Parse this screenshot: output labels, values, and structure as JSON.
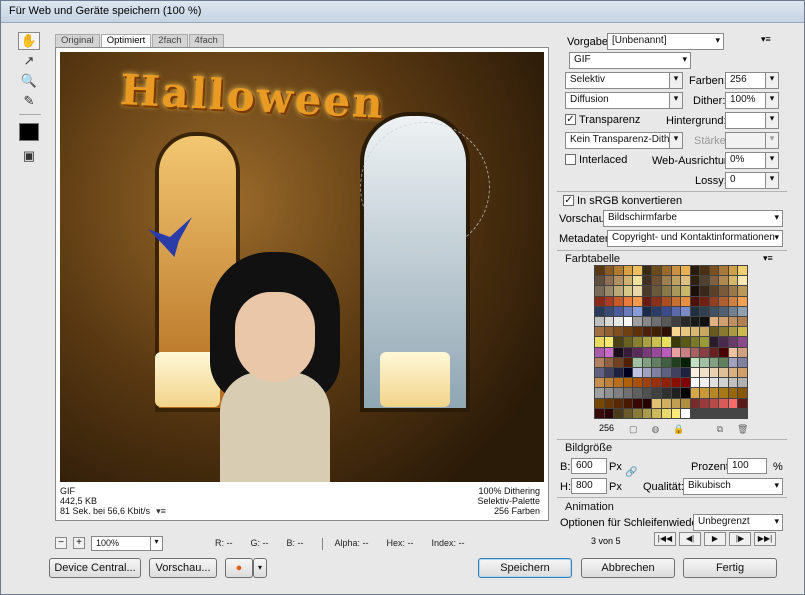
{
  "window": {
    "title": "Für Web und Geräte speichern (100 %)"
  },
  "tabs": [
    "Original",
    "Optimiert",
    "2fach",
    "4fach"
  ],
  "preview": {
    "title_art": "Halloween",
    "info_left": [
      "GIF",
      "442,5 KB",
      "81 Sek. bei 56,6 Kbit/s"
    ],
    "info_right": [
      "100% Dithering",
      "Selektiv-Palette",
      "256 Farben"
    ]
  },
  "status": {
    "zoom": "100%",
    "readouts": [
      "R: --",
      "G: --",
      "B: --",
      "Alpha: --",
      "Hex: --",
      "Index: --"
    ]
  },
  "buttons": {
    "device_central": "Device Central...",
    "preview": "Vorschau...",
    "save": "Speichern",
    "cancel": "Abbrechen",
    "done": "Fertig"
  },
  "settings": {
    "preset_label": "Vorgabe:",
    "preset_value": "[Unbenannt]",
    "format": "GIF",
    "reduction": "Selektiv",
    "colors_label": "Farben:",
    "colors_value": "256",
    "dither_algo": "Diffusion",
    "dither_label": "Dither:",
    "dither_value": "100%",
    "transparency_label": "Transparenz",
    "transparency_checked": true,
    "matte_label": "Hintergrund:",
    "matte_value": "",
    "transparency_dither": "Kein Transparenz-Dither",
    "amount_label": "Stärke:",
    "interlaced_label": "Interlaced",
    "interlaced_checked": false,
    "websnap_label": "Web-Ausrichtung:",
    "websnap_value": "0%",
    "lossy_label": "Lossy:",
    "lossy_value": "0",
    "srgb_label": "In sRGB konvertieren",
    "srgb_checked": true,
    "preview_label": "Vorschau:",
    "preview_value": "Bildschirmfarbe",
    "metadata_label": "Metadaten:",
    "metadata_value": "Copyright- und Kontaktinformationen"
  },
  "color_table": {
    "title": "Farbtabelle",
    "count": "256",
    "colors": [
      "#5a3a14",
      "#8a5a22",
      "#b07a2e",
      "#d8a040",
      "#f0c060",
      "#3a2a10",
      "#6a4a1a",
      "#9a6a2a",
      "#c89040",
      "#e8b050",
      "#2a1a08",
      "#4a3010",
      "#7a5020",
      "#a87838",
      "#d0a048",
      "#f0d070",
      "#605040",
      "#907050",
      "#b09060",
      "#d0b070",
      "#f0e0a0",
      "#403020",
      "#705030",
      "#a08050",
      "#c0a060",
      "#e0c080",
      "#302010",
      "#504030",
      "#806040",
      "#b08850",
      "#d8b868",
      "#f8e8b8",
      "#7a6a5a",
      "#9a8a6a",
      "#baa878",
      "#d8c888",
      "#e8d8a8",
      "#4a3a2a",
      "#6a5a3a",
      "#8a7a4a",
      "#aa985a",
      "#c8b86a",
      "#1a1008",
      "#3a2818",
      "#5a4028",
      "#7a5a38",
      "#9a7848",
      "#ba9858",
      "#8a2a1a",
      "#aa3a22",
      "#c85a2a",
      "#e87a3a",
      "#f89a4a",
      "#6a1a10",
      "#8a3018",
      "#aa5020",
      "#c87030",
      "#e89040",
      "#501008",
      "#702010",
      "#904020",
      "#b06030",
      "#d08040",
      "#f0a050",
      "#2a3a5a",
      "#3a4a7a",
      "#4a5a9a",
      "#6a7aba",
      "#8a9ada",
      "#1a2a4a",
      "#2a3a6a",
      "#3a4a8a",
      "#5a6aaa",
      "#7a8aca",
      "#203040",
      "#304050",
      "#405060",
      "#506070",
      "#708090",
      "#90a0b0",
      "#c0c0c0",
      "#d8d8d8",
      "#e8e8e8",
      "#f8f8f8",
      "#a0a0a0",
      "#888888",
      "#707070",
      "#585858",
      "#404040",
      "#282828",
      "#181818",
      "#101010",
      "#e0b080",
      "#d0a070",
      "#c09060",
      "#b08050",
      "#a07040",
      "#906030",
      "#805020",
      "#704010",
      "#603008",
      "#502004",
      "#402002",
      "#301000",
      "#f8d890",
      "#e8c880",
      "#d8b870",
      "#c8a860",
      "#6a5a20",
      "#8a7a30",
      "#aa9a40",
      "#caba50",
      "#eada60",
      "#fae870",
      "#4a4010",
      "#6a6020",
      "#8a8030",
      "#aaa040",
      "#cac050",
      "#eae060",
      "#3a3a08",
      "#5a5a18",
      "#7a7a28",
      "#9a9a38",
      "#2a1a2a",
      "#4a2a4a",
      "#6a3a6a",
      "#8a4a8a",
      "#aa5aaa",
      "#ca6aca",
      "#1a0a1a",
      "#3a1a3a",
      "#5a2a5a",
      "#7a3a7a",
      "#9a4a9a",
      "#ba5aba",
      "#e8a0a0",
      "#c88080",
      "#a86060",
      "#884040",
      "#682020",
      "#480000",
      "#f0c0a0",
      "#d0a080",
      "#b08060",
      "#906040",
      "#704020",
      "#502000",
      "#a0c0a0",
      "#80a080",
      "#608060",
      "#406040",
      "#204020",
      "#002000",
      "#c0e0c0",
      "#a0c0a0",
      "#80a080",
      "#608060",
      "#a0a0c0",
      "#8080a0",
      "#606080",
      "#404060",
      "#202040",
      "#000020",
      "#c0c0e0",
      "#a0a0c0",
      "#8080a0",
      "#606080",
      "#404060",
      "#202040",
      "#f8f0e0",
      "#f0e0c8",
      "#e8d0b0",
      "#e0c098",
      "#d8b080",
      "#d0a068",
      "#c89050",
      "#c08038",
      "#b87020",
      "#b06008",
      "#a85000",
      "#a04000",
      "#983000",
      "#902000",
      "#881000",
      "#800000",
      "#ffffff",
      "#f0f0f0",
      "#e0e0e0",
      "#d0d0d0",
      "#c0c0c0",
      "#b0b0b0",
      "#a0a0a0",
      "#909090",
      "#808080",
      "#707070",
      "#606060",
      "#505050",
      "#404040",
      "#303030",
      "#202020",
      "#000000",
      "#d8a848",
      "#c89838",
      "#b88828",
      "#a87818",
      "#986808",
      "#885800",
      "#784800",
      "#683800",
      "#582800",
      "#481800",
      "#380800",
      "#280000",
      "#e0c070",
      "#d0b060",
      "#c0a050",
      "#b09040",
      "#7a2a2a",
      "#9a3a3a",
      "#ba4a4a",
      "#da5a5a",
      "#fa6a6a",
      "#5a1a1a",
      "#3a0a0a",
      "#2a0000",
      "#4a3a1a",
      "#6a5a2a",
      "#8a7a3a",
      "#aa9a4a",
      "#caba5a",
      "#eada6a",
      "#faea7a",
      "#ffffff"
    ]
  },
  "image_size": {
    "title": "Bildgröße",
    "width_label": "B:",
    "width_value": "600",
    "height_label": "H:",
    "height_value": "800",
    "unit": "Px",
    "percent_label": "Prozent:",
    "percent_value": "100",
    "percent_unit": "%",
    "quality_label": "Qualität:",
    "quality_value": "Bikubisch"
  },
  "animation": {
    "title": "Animation",
    "loop_label": "Optionen für Schleifenwiedergabe:",
    "loop_value": "Unbegrenzt",
    "frame_counter": "3 von 5"
  }
}
